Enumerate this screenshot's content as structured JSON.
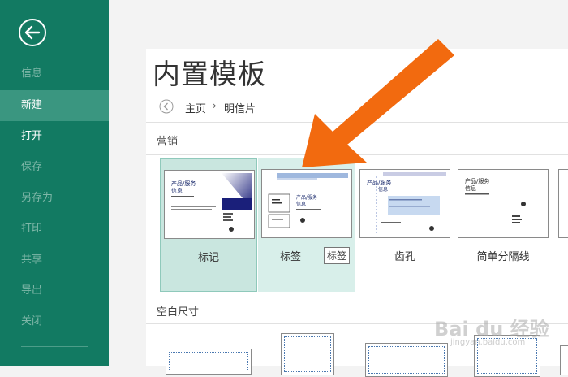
{
  "sidebar": {
    "items": [
      {
        "label": "信息"
      },
      {
        "label": "新建"
      },
      {
        "label": "打开"
      },
      {
        "label": "保存"
      },
      {
        "label": "另存为"
      },
      {
        "label": "打印"
      },
      {
        "label": "共享"
      },
      {
        "label": "导出"
      },
      {
        "label": "关闭"
      }
    ]
  },
  "main": {
    "title": "内置模板",
    "breadcrumb": {
      "home": "主页",
      "separator": "›",
      "current": "明信片"
    },
    "section_marketing": "营销",
    "section_blank": "空白尺寸",
    "templates": [
      {
        "label": "标记",
        "thumb_text_1": "产品/服务",
        "thumb_text_2": "信息"
      },
      {
        "label": "标签",
        "thumb_text_1": "产品/服务",
        "thumb_text_2": "信息",
        "tooltip": "标签"
      },
      {
        "label": "齿孔",
        "thumb_text_1": "产品/服务",
        "thumb_text_2": "信息"
      },
      {
        "label": "简单分隔线",
        "thumb_text_1": "产品/服务",
        "thumb_text_2": "信息"
      }
    ]
  },
  "watermark": {
    "text": "Bai du 经验",
    "sub": "jingyan.baidu.com"
  },
  "colors": {
    "sidebar": "#127a62",
    "selected": "#c9e6df",
    "arrow": "#f26a0f"
  }
}
